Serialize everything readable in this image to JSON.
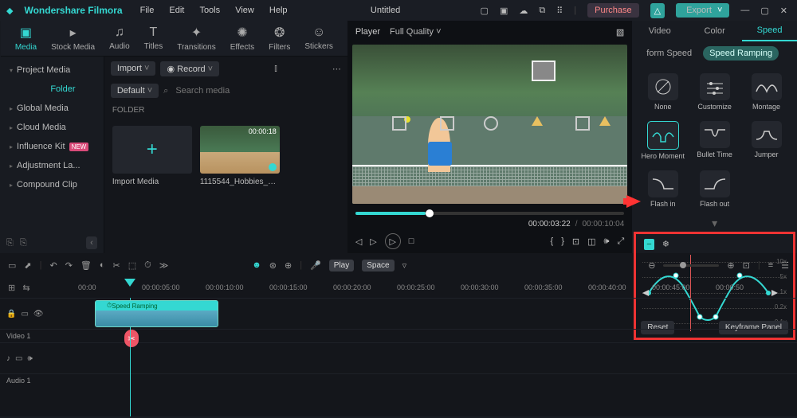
{
  "app": {
    "name": "Wondershare Filmora",
    "title": "Untitled"
  },
  "menu": [
    "File",
    "Edit",
    "Tools",
    "View",
    "Help"
  ],
  "topbtns": {
    "purchase": "Purchase",
    "export": "Export"
  },
  "tabs": [
    {
      "icon": "▣",
      "label": "Media",
      "active": true
    },
    {
      "icon": "▸",
      "label": "Stock Media"
    },
    {
      "icon": "♫",
      "label": "Audio"
    },
    {
      "icon": "T",
      "label": "Titles"
    },
    {
      "icon": "✦",
      "label": "Transitions"
    },
    {
      "icon": "✺",
      "label": "Effects"
    },
    {
      "icon": "❂",
      "label": "Filters"
    },
    {
      "icon": "☺",
      "label": "Stickers"
    }
  ],
  "tree": {
    "head": "Project Media",
    "selected": "Folder",
    "items": [
      "Global Media",
      "Cloud Media",
      {
        "label": "Influence Kit",
        "badge": "NEW"
      },
      "Adjustment La...",
      "Compound Clip"
    ]
  },
  "center": {
    "import": "Import",
    "record": "Record",
    "default": "Default",
    "search_ph": "Search media",
    "folder_h": "FOLDER",
    "cards": [
      {
        "label": "Import Media",
        "add": true
      },
      {
        "label": "1115544_Hobbies_Tennis_19...",
        "dur": "00:00:18"
      }
    ]
  },
  "preview": {
    "player": "Player",
    "quality": "Full Quality",
    "cur": "00:00:03:22",
    "total": "00:00:10:04"
  },
  "right": {
    "tabs": [
      "Video",
      "Color",
      "Speed"
    ],
    "active": 2,
    "subs": [
      "form Speed",
      "Speed Ramping"
    ],
    "sub_active": 1,
    "presets": [
      "None",
      "Customize",
      "Montage",
      "Hero Moment",
      "Bullet Time",
      "Jumper",
      "Flash in",
      "Flash out"
    ],
    "preset_sel": 3,
    "reset": "Reset",
    "keyframe": "Keyframe Panel",
    "speed_marks": [
      "10x",
      "5x",
      "1x",
      "0.2x",
      "0.1x"
    ]
  },
  "timeline": {
    "play": "Play",
    "space": "Space",
    "ticks": [
      "00:00",
      "00:00:05:00",
      "00:00:10:00",
      "00:00:15:00",
      "00:00:20:00",
      "00:00:25:00",
      "00:00:30:00",
      "00:00:35:00",
      "00:00:40:00",
      "00:00:45:00",
      "00:00:50"
    ],
    "video_track": "Video 1",
    "audio_track": "Audio 1",
    "clip_label": "Speed Ramping"
  }
}
